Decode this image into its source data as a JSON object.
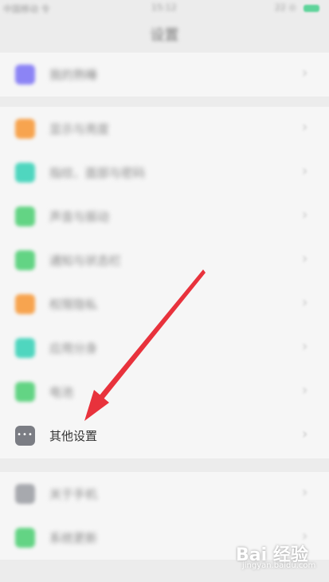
{
  "status_bar": {
    "carrier": "中国移动 令",
    "time": "15:12",
    "battery_text": "22 ⊙"
  },
  "header": {
    "title": "设置"
  },
  "rows": [
    {
      "label": "我的熟睡",
      "color": "#8c84f5"
    },
    {
      "label": "显示与亮度",
      "color": "#f7a44f"
    },
    {
      "label": "指纹、面部与密码",
      "color": "#4fd6bf"
    },
    {
      "label": "声音与振动",
      "color": "#63d484"
    },
    {
      "label": "通知与状态栏",
      "color": "#63d484"
    },
    {
      "label": "权限隐私",
      "color": "#f7a44f"
    },
    {
      "label": "应用分身",
      "color": "#4fd6bf"
    },
    {
      "label": "电池",
      "color": "#63d484"
    },
    {
      "label": "其他设置",
      "color": "#7b7d84"
    },
    {
      "label": "关于手机",
      "color": "#a7a9ae"
    },
    {
      "label": "系统更新",
      "color": "#63d484"
    }
  ],
  "chevron_glyph": "›",
  "more_icon_glyph": "•••",
  "annotation": {
    "color": "#e8323c"
  },
  "watermark": {
    "brand": "Bai 经验",
    "sub": "jingyan.baidu.com"
  }
}
